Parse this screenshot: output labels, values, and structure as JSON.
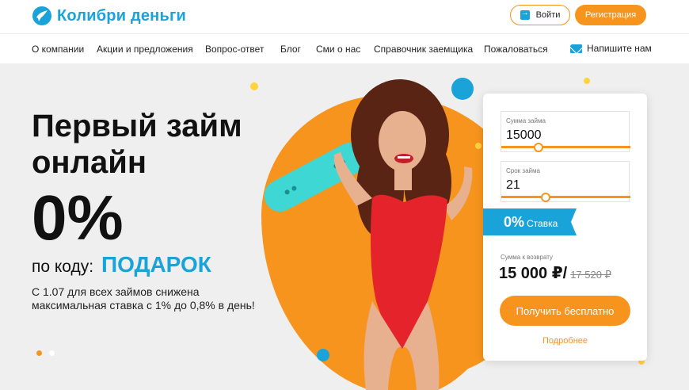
{
  "brand": {
    "name": "Колибри деньги",
    "color": "#1aa3d9",
    "accent": "#f7941d"
  },
  "header": {
    "login_label": "Войти",
    "register_label": "Регистрация"
  },
  "nav": {
    "items": [
      "О компании",
      "Акции и предложения",
      "Вопрос-ответ",
      "Блог",
      "Сми о нас",
      "Справочник заемщика",
      "Пожаловаться"
    ],
    "contact_label": "Напишите нам"
  },
  "hero": {
    "headline_line1": "Первый займ",
    "headline_line2": "онлайн",
    "percent": "0%",
    "promo_prefix": "по коду:",
    "promo_code": "ПОДАРОК",
    "note": "С 1.07 для всех займов снижена максимальная ставка с 1% до 0,8% в день!"
  },
  "calculator": {
    "amount_label": "Сумма займа",
    "amount_value": "15000",
    "amount_slider_position": 0.27,
    "term_label": "Срок займа",
    "term_value": "21",
    "term_slider_position": 0.33,
    "rate_value": "0%",
    "rate_label": "Ставка",
    "return_label": "Сумма к возврату",
    "return_value": "15 000 ₽/",
    "return_old": "17 520 ₽",
    "submit_label": "Получить бесплатно",
    "more_label": "Подробнее"
  }
}
